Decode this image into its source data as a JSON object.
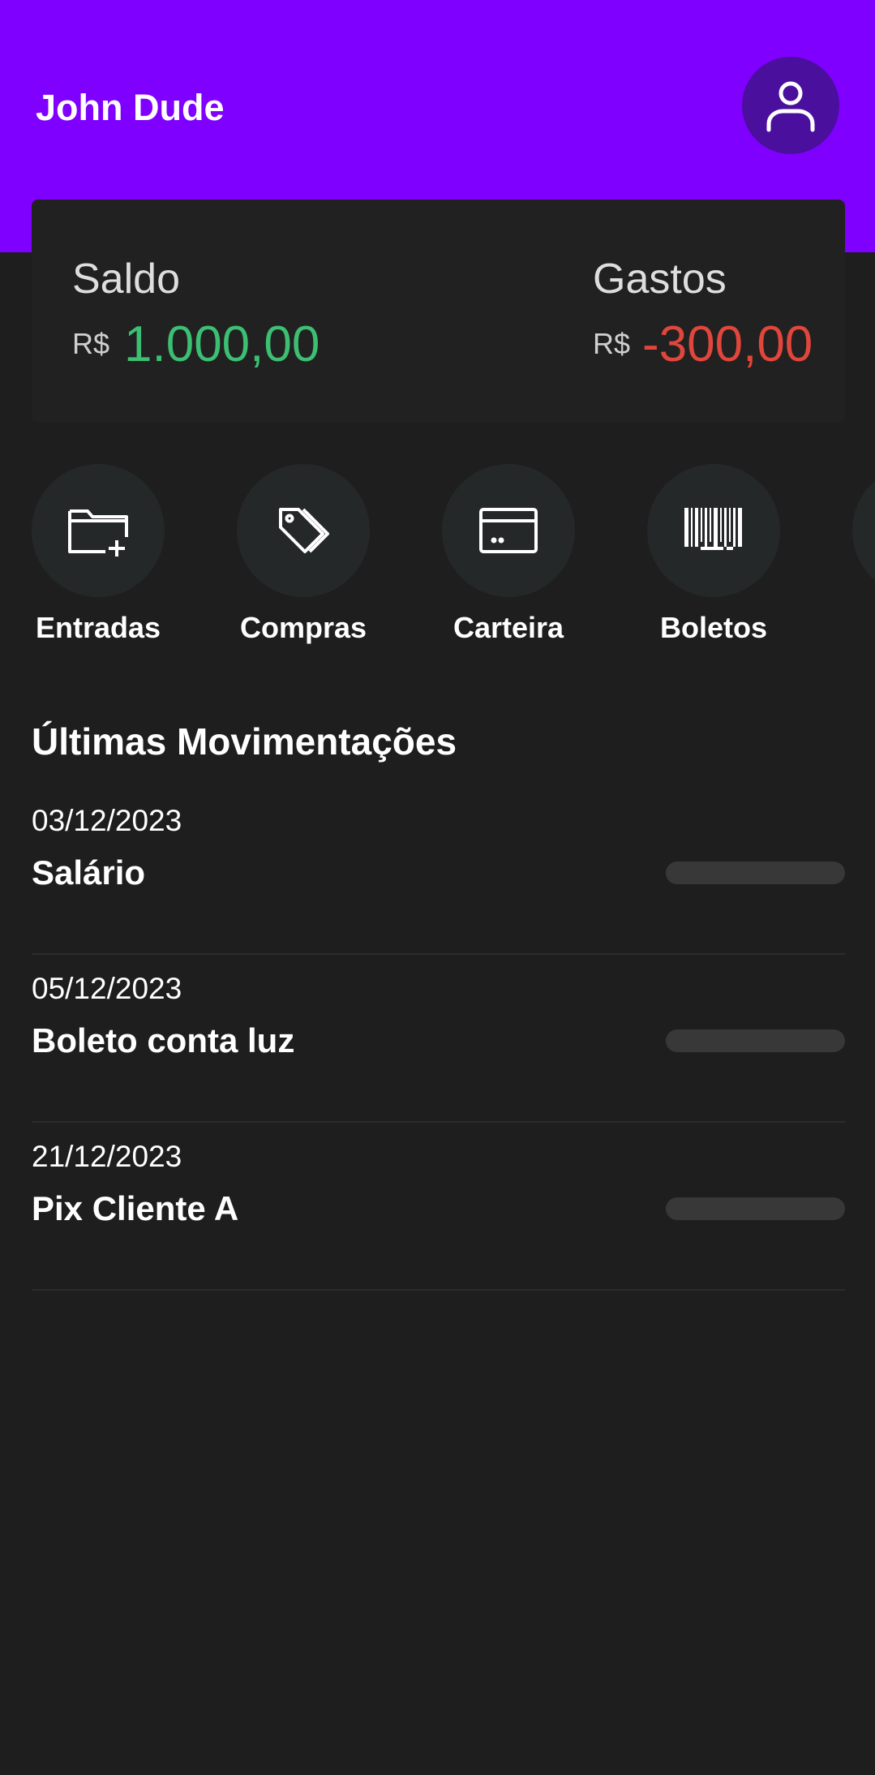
{
  "header": {
    "user_name": "John Dude",
    "bg_color": "#7f00ff",
    "avatar_icon": "user-icon"
  },
  "balance": {
    "saldo_label": "Saldo",
    "saldo_currency": "R$",
    "saldo_value": "1.000,00",
    "saldo_color": "#3cbf72",
    "gastos_label": "Gastos",
    "gastos_currency": "R$",
    "gastos_value": "-300,00",
    "gastos_color": "#e0463b"
  },
  "actions": [
    {
      "label": "Entradas",
      "icon": "folder-plus-icon"
    },
    {
      "label": "Compras",
      "icon": "tags-icon"
    },
    {
      "label": "Carteira",
      "icon": "credit-card-icon"
    },
    {
      "label": "Boletos",
      "icon": "barcode-icon"
    }
  ],
  "transactions": {
    "title": "Últimas Movimentações",
    "items": [
      {
        "date": "03/12/2023",
        "title": "Salário"
      },
      {
        "date": "05/12/2023",
        "title": "Boleto conta luz"
      },
      {
        "date": "21/12/2023",
        "title": "Pix Cliente A"
      }
    ]
  }
}
